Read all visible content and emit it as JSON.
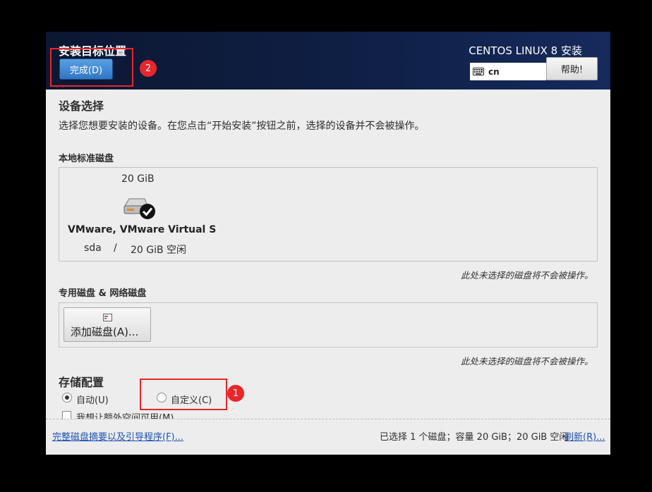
{
  "header": {
    "title": "安装目标位置",
    "done_label": "完成(D)",
    "product": "CENTOS LINUX 8 安装",
    "keyboard_layout": "cn",
    "help_label": "帮助!"
  },
  "device_selection": {
    "heading": "设备选择",
    "description": "选择您想要安装的设备。在您点击“开始安装”按钮之前，选择的设备并不会被操作。"
  },
  "local_disks": {
    "heading": "本地标准磁盘",
    "disk": {
      "size": "20 GiB",
      "name": "VMware, VMware Virtual S",
      "device": "sda",
      "separator": "/",
      "free": "20 GiB 空闲",
      "selected": true
    },
    "note": "此处未选择的磁盘将不会被操作。"
  },
  "special_disks": {
    "heading": "专用磁盘 & 网络磁盘",
    "add_label": "添加磁盘(A)...",
    "note": "此处未选择的磁盘将不会被操作。"
  },
  "storage_config": {
    "heading": "存储配置",
    "auto_label": "自动(U)",
    "custom_label": "自定义(C)",
    "extra_space_label": "我想让额外空间可用(M)"
  },
  "annotations": {
    "marker1": "1",
    "marker2": "2"
  },
  "footer": {
    "summary_link": "完整磁盘摘要以及引导程序(F)...",
    "status": "已选择 1 个磁盘；容量 20 GiB；20 GiB 空闲",
    "refresh_link": "刷新(R)..."
  },
  "colors": {
    "header_bg": "#0f1f45",
    "primary_button": "#3a82d2",
    "annotation_red": "#e8262b",
    "link": "#1d52b5"
  }
}
